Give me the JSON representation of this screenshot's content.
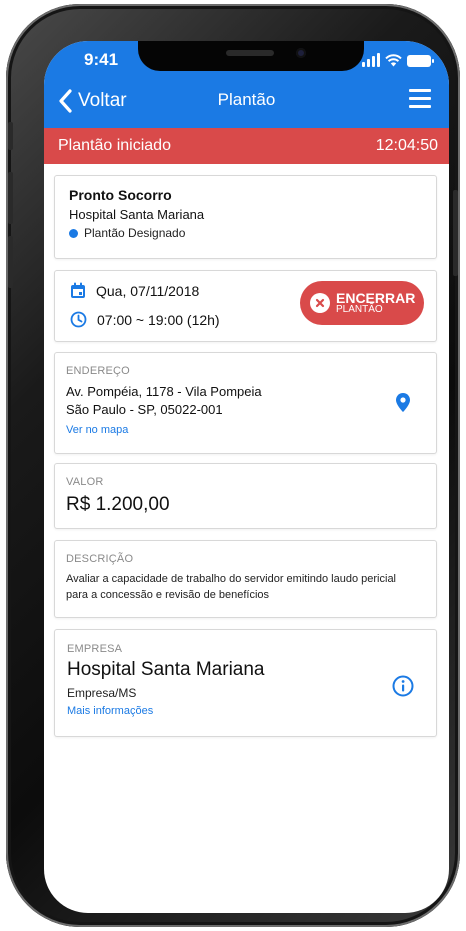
{
  "status_bar": {
    "time": "9:41"
  },
  "nav": {
    "back_label": "Voltar",
    "title": "Plantão"
  },
  "banner": {
    "label": "Plantão iniciado",
    "timer": "12:04:50"
  },
  "shift_card": {
    "title": "Pronto Socorro",
    "hospital": "Hospital Santa Mariana",
    "status": "Plantão Designado",
    "status_color": "#1b7ae4"
  },
  "schedule_card": {
    "date": "Qua, 07/11/2018",
    "time_range": "07:00 ~ 19:00 (12h)",
    "end_button_main": "ENCERRAR",
    "end_button_sub": "PLANTÃO"
  },
  "address_card": {
    "label": "ENDEREÇO",
    "line1": "Av. Pompéia, 1178 - Vila Pompeia",
    "line2": "São Paulo - SP, 05022-001",
    "map_link": "Ver no mapa"
  },
  "value_card": {
    "label": "VALOR",
    "value": "R$ 1.200,00"
  },
  "description_card": {
    "label": "DESCRIÇÃO",
    "line1": "Avaliar a capacidade de trabalho do servidor emitindo laudo pericial",
    "line2": "para a concessão e revisão de benefícios"
  },
  "company_card": {
    "label": "EMPRESA",
    "name": "Hospital Santa Mariana",
    "sub": "Empresa/MS",
    "more_link": "Mais informações"
  },
  "colors": {
    "primary": "#1b7ae4",
    "danger": "#d94a4a"
  },
  "icons": [
    "chevron-left-icon",
    "menu-icon",
    "calendar-icon",
    "clock-icon",
    "close-circle-icon",
    "location-pin-icon",
    "info-icon"
  ]
}
